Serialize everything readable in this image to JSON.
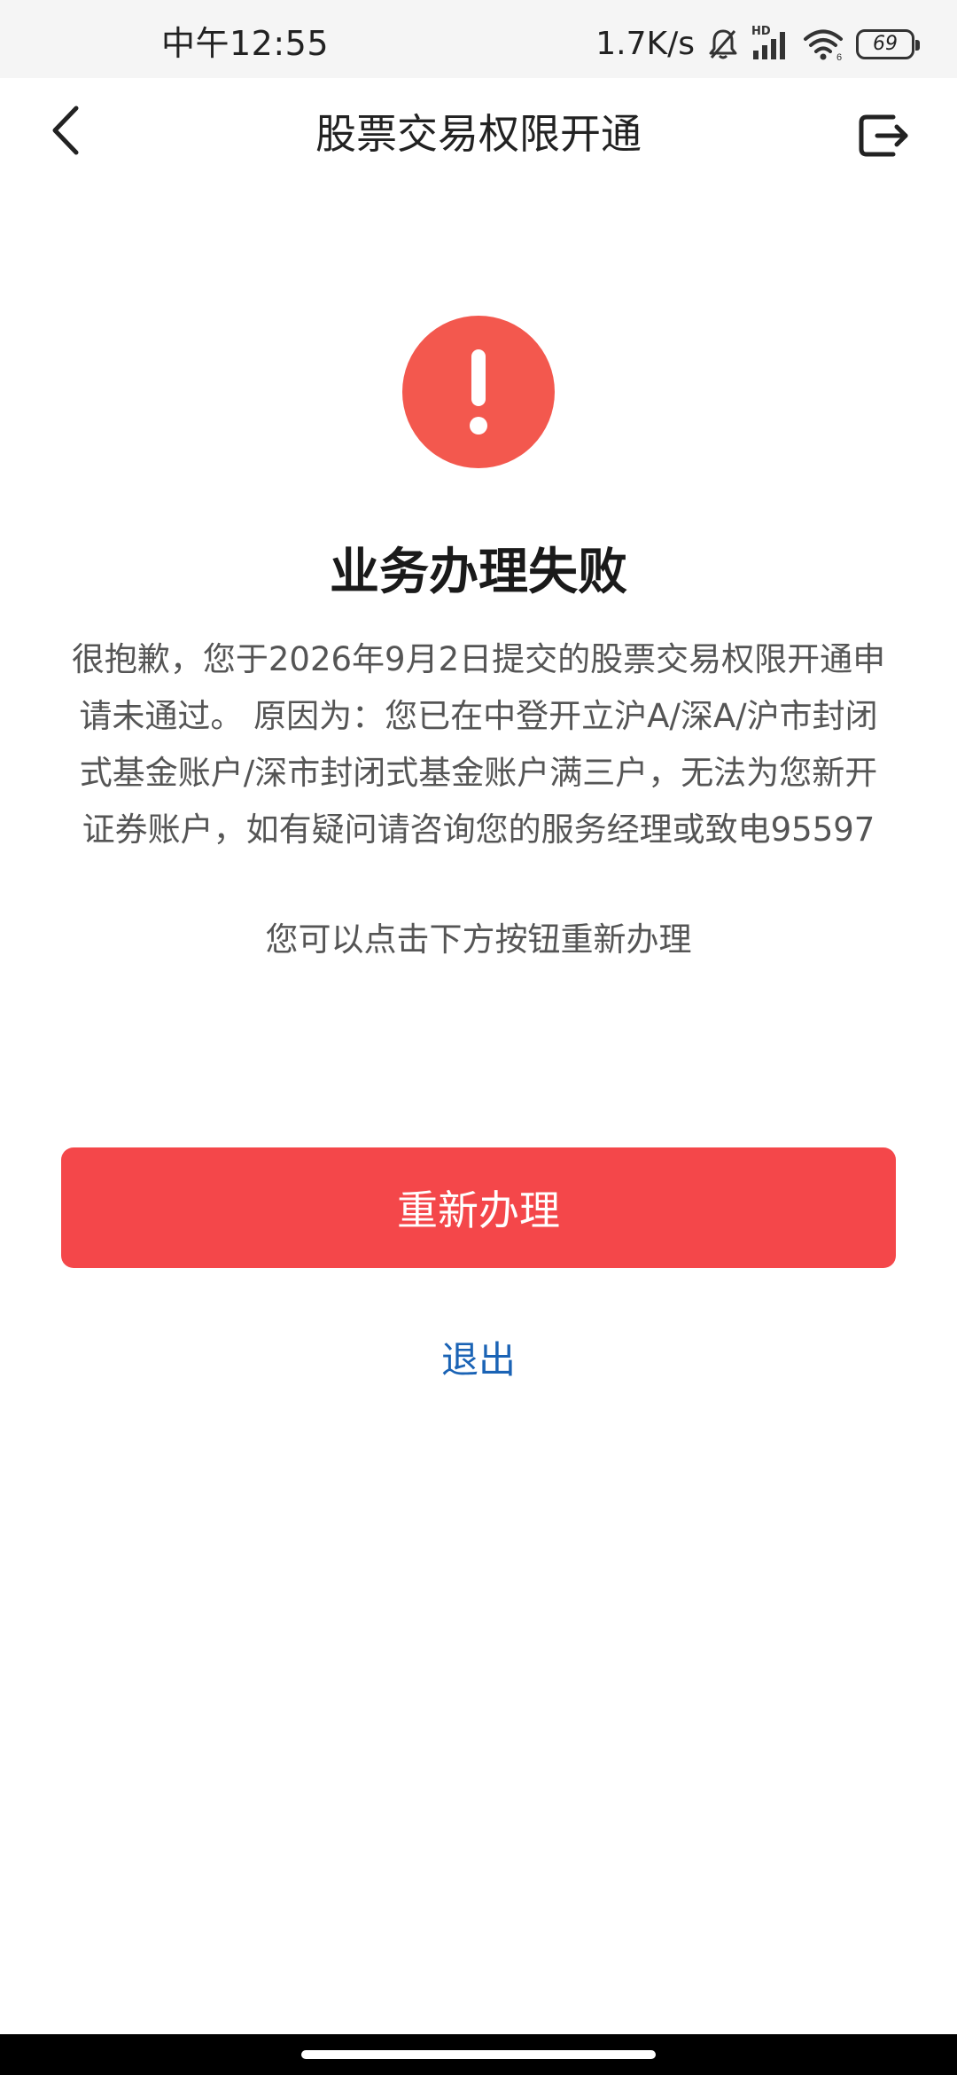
{
  "status_bar": {
    "time": "中午12:55",
    "net_speed": "1.7K/s",
    "network_badge": "HD",
    "battery": "69",
    "icons": [
      "bell-muted-icon",
      "signal-icon",
      "wifi-icon",
      "battery-icon"
    ]
  },
  "nav": {
    "title": "股票交易权限开通",
    "back_icon": "chevron-left-icon",
    "exit_icon": "exit-icon"
  },
  "result": {
    "icon": "exclamation-icon",
    "icon_color": "#f3584e",
    "title": "业务办理失败",
    "description": "很抱歉，您于2026年9月2日提交的股票交易权限开通申请未通过。 原因为：您已在中登开立沪A/深A/沪市封闭式基金账户/深市封闭式基金账户满三户，无法为您新开证券账户，如有疑问请咨询您的服务经理或致电95597",
    "hint": "您可以点击下方按钮重新办理"
  },
  "actions": {
    "retry_label": "重新办理",
    "retry_color": "#f4474a",
    "exit_label": "退出",
    "exit_color": "#1a63b5"
  }
}
